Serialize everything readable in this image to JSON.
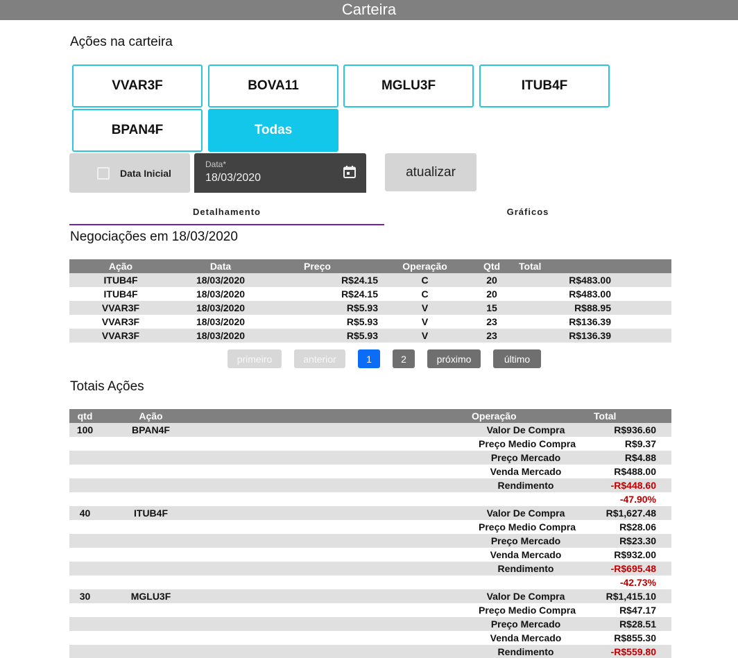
{
  "header": {
    "title": "Carteira"
  },
  "portfolio": {
    "title": "Ações na carteira",
    "stocks": [
      "VVAR3F",
      "BOVA11",
      "MGLU3F",
      "ITUB4F",
      "BPAN4F"
    ],
    "all_label": "Todas"
  },
  "filters": {
    "initial_date_label": "Data Inicial",
    "date_caption": "Data*",
    "date_value": "18/03/2020",
    "update_label": "atualizar"
  },
  "tabs": {
    "detail": "Detalhamento",
    "charts": "Gráficos"
  },
  "trades": {
    "title": "Negociações em 18/03/2020",
    "columns": [
      "Ação",
      "Data",
      "Preço",
      "Operação",
      "Qtd",
      "Total"
    ],
    "rows": [
      [
        "ITUB4F",
        "18/03/2020",
        "R$24.15",
        "C",
        "20",
        "R$483.00"
      ],
      [
        "ITUB4F",
        "18/03/2020",
        "R$24.15",
        "C",
        "20",
        "R$483.00"
      ],
      [
        "VVAR3F",
        "18/03/2020",
        "R$5.93",
        "V",
        "15",
        "R$88.95"
      ],
      [
        "VVAR3F",
        "18/03/2020",
        "R$5.93",
        "V",
        "23",
        "R$136.39"
      ],
      [
        "VVAR3F",
        "18/03/2020",
        "R$5.93",
        "V",
        "23",
        "R$136.39"
      ]
    ]
  },
  "pagination": {
    "first": "primeiro",
    "previous": "anterior",
    "page1": "1",
    "page2": "2",
    "next": "próximo",
    "last": "último"
  },
  "totals": {
    "title": "Totais Ações",
    "columns": [
      "qtd",
      "Ação",
      "Operação",
      "Total"
    ],
    "rows": [
      [
        "100",
        "BPAN4F",
        "Valor De Compra",
        "R$936.60"
      ],
      [
        "",
        "",
        "Preço Medio Compra",
        "R$9.37"
      ],
      [
        "",
        "",
        "Preço Mercado",
        "R$4.88"
      ],
      [
        "",
        "",
        "Venda Mercado",
        "R$488.00"
      ],
      [
        "",
        "",
        "Rendimento",
        "-R$448.60"
      ],
      [
        "",
        "",
        "",
        "-47.90%"
      ],
      [
        "40",
        "ITUB4F",
        "Valor De Compra",
        "R$1,627.48"
      ],
      [
        "",
        "",
        "Preço Medio Compra",
        "R$28.06"
      ],
      [
        "",
        "",
        "Preço Mercado",
        "R$23.30"
      ],
      [
        "",
        "",
        "Venda Mercado",
        "R$932.00"
      ],
      [
        "",
        "",
        "Rendimento",
        "-R$695.48"
      ],
      [
        "",
        "",
        "",
        "-42.73%"
      ],
      [
        "30",
        "MGLU3F",
        "Valor De Compra",
        "R$1,415.10"
      ],
      [
        "",
        "",
        "Preço Medio Compra",
        "R$47.17"
      ],
      [
        "",
        "",
        "Preço Mercado",
        "R$28.51"
      ],
      [
        "",
        "",
        "Venda Mercado",
        "R$855.30"
      ],
      [
        "",
        "",
        "Rendimento",
        "-R$559.80"
      ]
    ]
  },
  "colors": {
    "accent": "#12c7ea",
    "negative": "#c00000",
    "tab_indicator": "#7b1fa2",
    "page_active": "#0b6cf5"
  }
}
